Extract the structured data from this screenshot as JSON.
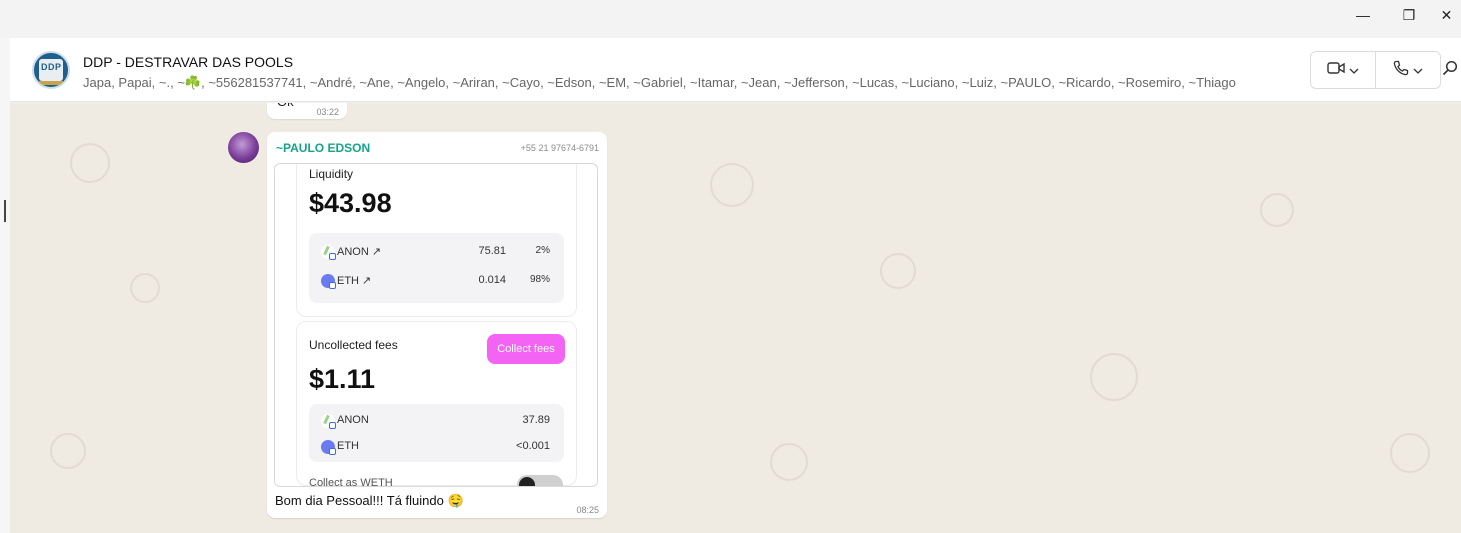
{
  "window": {
    "minimize_glyph": "—",
    "maximize_glyph": "❐",
    "close_glyph": "✕"
  },
  "header": {
    "avatar_text": "DDP",
    "title": "DDP - DESTRAVAR DAS POOLS",
    "participants": "Japa, Papai, ~., ~☘️, ~556281537741, ~André, ~Ane, ~Angelo, ~Ariran, ~Cayo, ~Edson, ~EM, ~Gabriel, ~Itamar, ~Jean, ~Jefferson, ~Lucas, ~Luciano, ~Luiz, ~PAULO, ~Ricardo, ~Rosemiro, ~Thiago",
    "video_call_icon": "video-camera-icon",
    "voice_call_icon": "phone-icon",
    "search_icon": "search-icon"
  },
  "previous_message": {
    "text": "Ok",
    "time": "03:22"
  },
  "message": {
    "sender_name": "~PAULO EDSON",
    "sender_phone": "+55 21 97674-6791",
    "caption": "Bom dia Pessoal!!! Tá fluindo 🤤",
    "time": "08:25",
    "screenshot": {
      "liquidity": {
        "label": "Liquidity",
        "total": "$43.98",
        "tokens": [
          {
            "name": "ANON ↗",
            "amount": "75.81",
            "pct": "2%"
          },
          {
            "name": "ETH ↗",
            "amount": "0.014",
            "pct": "98%"
          }
        ]
      },
      "fees": {
        "label": "Uncollected fees",
        "collect_button": "Collect fees",
        "total": "$1.11",
        "tokens": [
          {
            "name": "ANON",
            "amount": "37.89"
          },
          {
            "name": "ETH",
            "amount": "<0.001"
          }
        ],
        "cut_label": "Collect as WETH"
      }
    }
  },
  "colors": {
    "chat_background": "#efeae2",
    "sender_name": "#15a38a",
    "collect_button": "#f464f4"
  }
}
